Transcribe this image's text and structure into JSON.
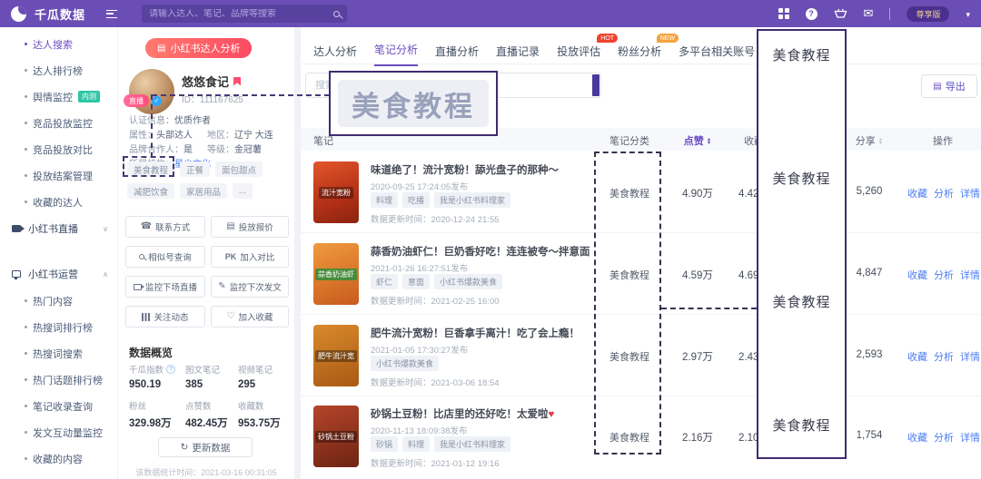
{
  "colors": {
    "topbar": "#6B4EB5",
    "accent": "#6C4EC2",
    "link": "#4D7DF2",
    "hot": "#F0432C",
    "new": "#F6A23C",
    "annotation": "#3F2A70",
    "live_badge": "#FF5F8E",
    "beta_badge": "#2FC6A4"
  },
  "icons": {
    "search": "magnifier",
    "menu": "hamburger",
    "apps": "grid",
    "help": "?",
    "cart": "shopping-cart",
    "mail": "envelope",
    "dropdown": "chevron-down",
    "phone": "☎",
    "quote-doc": "▤",
    "similar-search": "magnifier",
    "monitor-live": "camera",
    "monitor-post": "✎",
    "follow-trend": "chart-bars",
    "favorite": "♡",
    "refresh": "↻",
    "export": "▤",
    "verified": "check",
    "live": "camera"
  },
  "topbar": {
    "brand": "千瓜数据",
    "search_placeholder": "请输入达人、笔记、品牌等搜索",
    "version": "尊享版"
  },
  "sidebar": {
    "items": [
      {
        "label": "达人搜索"
      },
      {
        "label": "达人排行榜"
      },
      {
        "label": "舆情监控",
        "badge": "内测"
      },
      {
        "label": "竞品投放监控"
      },
      {
        "label": "竞品投放对比"
      },
      {
        "label": "投放结案管理"
      },
      {
        "label": "收藏的达人"
      }
    ],
    "groups": [
      {
        "label": "小红书直播"
      },
      {
        "label": "小红书运营"
      }
    ],
    "sub_items": [
      "热门内容",
      "热搜词排行榜",
      "热搜词搜索",
      "热门话题排行榜",
      "笔记收录查询",
      "发文互动量监控",
      "收藏的内容"
    ]
  },
  "profile": {
    "analysis_button": "小红书达人分析",
    "live_badge": "直播",
    "name": "悠悠食记",
    "id": "ID：111167625",
    "fields": {
      "cert_label": "认证信息：",
      "cert": "优质作者",
      "attr_label": "属性：",
      "attr": "头部达人",
      "region_label": "地区：",
      "region": "辽宁 大连",
      "brand_label": "品牌合作人：",
      "brand": "是",
      "level_label": "等级：",
      "level": "金冠薯",
      "org_label": "所属机构：",
      "org": "星尘文化"
    },
    "tags": [
      "美食教程",
      "正餐",
      "面包甜点",
      "减肥饮食",
      "家居用品",
      "..."
    ],
    "pk": "PK",
    "buttons": [
      "联系方式",
      "投放报价",
      "相似号查询",
      "加入对比",
      "监控下场直播",
      "监控下次发文",
      "关注动态",
      "加入收藏"
    ],
    "overview": {
      "title": "数据概览",
      "stats": [
        {
          "label": "千瓜指数",
          "value": "950.19"
        },
        {
          "label": "图文笔记",
          "value": "385"
        },
        {
          "label": "视频笔记",
          "value": "295"
        },
        {
          "label": "粉丝",
          "value": "329.98万"
        },
        {
          "label": "点赞数",
          "value": "482.45万"
        },
        {
          "label": "收藏数",
          "value": "953.75万"
        }
      ],
      "update_button": "更新数据",
      "stat_time": "该数据统计时间：2021-03-16 00:31:05"
    }
  },
  "main": {
    "tabs": [
      {
        "label": "达人分析"
      },
      {
        "label": "笔记分析"
      },
      {
        "label": "直播分析"
      },
      {
        "label": "直播记录"
      },
      {
        "label": "投放评估",
        "badge": "HOT"
      },
      {
        "label": "粉丝分析",
        "badge": "NEW"
      },
      {
        "label": "多平台相关账号"
      }
    ],
    "search_placeholder": "搜索",
    "export_label": "导出",
    "table": {
      "headers": {
        "note": "笔记",
        "category": "笔记分类",
        "likes": "点赞",
        "collects": "收藏",
        "shares": "分享",
        "actions": "操作"
      },
      "ops": [
        "收藏",
        "分析",
        "详情"
      ],
      "rows": [
        {
          "title": "味道绝了！流汁宽粉！舔光盘子的那种～",
          "date": "2020-09-25 17:24:05发布",
          "tags": [
            "料理",
            "吃播",
            "我是小红书料理家"
          ],
          "updated": "数据更新时间：2020-12-24 21:55",
          "category": "美食教程",
          "likes": "4.90万",
          "collects": "4.42万",
          "shares": "5,260",
          "thumb": "流汁宽粉"
        },
        {
          "title": "蒜香奶油虾仁！巨奶香好吃！连连被夸～拌意面",
          "date": "2021-01-26 16:27:51发布",
          "tags": [
            "虾仁",
            "意面",
            "小红书爆款美食"
          ],
          "updated": "数据更新时间：2021-02-25 16:00",
          "category": "美食教程",
          "likes": "4.59万",
          "collects": "4.69万",
          "shares": "4,847",
          "thumb": "蒜香奶油虾"
        },
        {
          "title": "肥牛流汁宽粉！巨香拿手离汁！吃了会上瘾！",
          "date": "2021-01-05 17:30:27发布",
          "tags": [
            "小红书爆款美食"
          ],
          "updated": "数据更新时间：2021-03-06 18:54",
          "category": "美食教程",
          "likes": "2.97万",
          "collects": "2.43万",
          "shares": "2,593",
          "thumb": "肥牛流汁宽"
        },
        {
          "title": "砂锅土豆粉！比店里的还好吃！太爱啦",
          "heart": "♥",
          "date": "2020-11-13 18:09:38发布",
          "tags": [
            "砂锅",
            "料理",
            "我是小红书料理家"
          ],
          "updated": "数据更新时间：2021-01-12 19:16",
          "category": "美食教程",
          "likes": "2.16万",
          "collects": "2.10万",
          "shares": "1,754",
          "thumb": "砂锅土豆粉"
        }
      ]
    }
  },
  "annotation": {
    "highlight_text": "美食教程",
    "overlay_items": [
      "美食教程",
      "美食教程",
      "美食教程",
      "美食教程"
    ]
  }
}
